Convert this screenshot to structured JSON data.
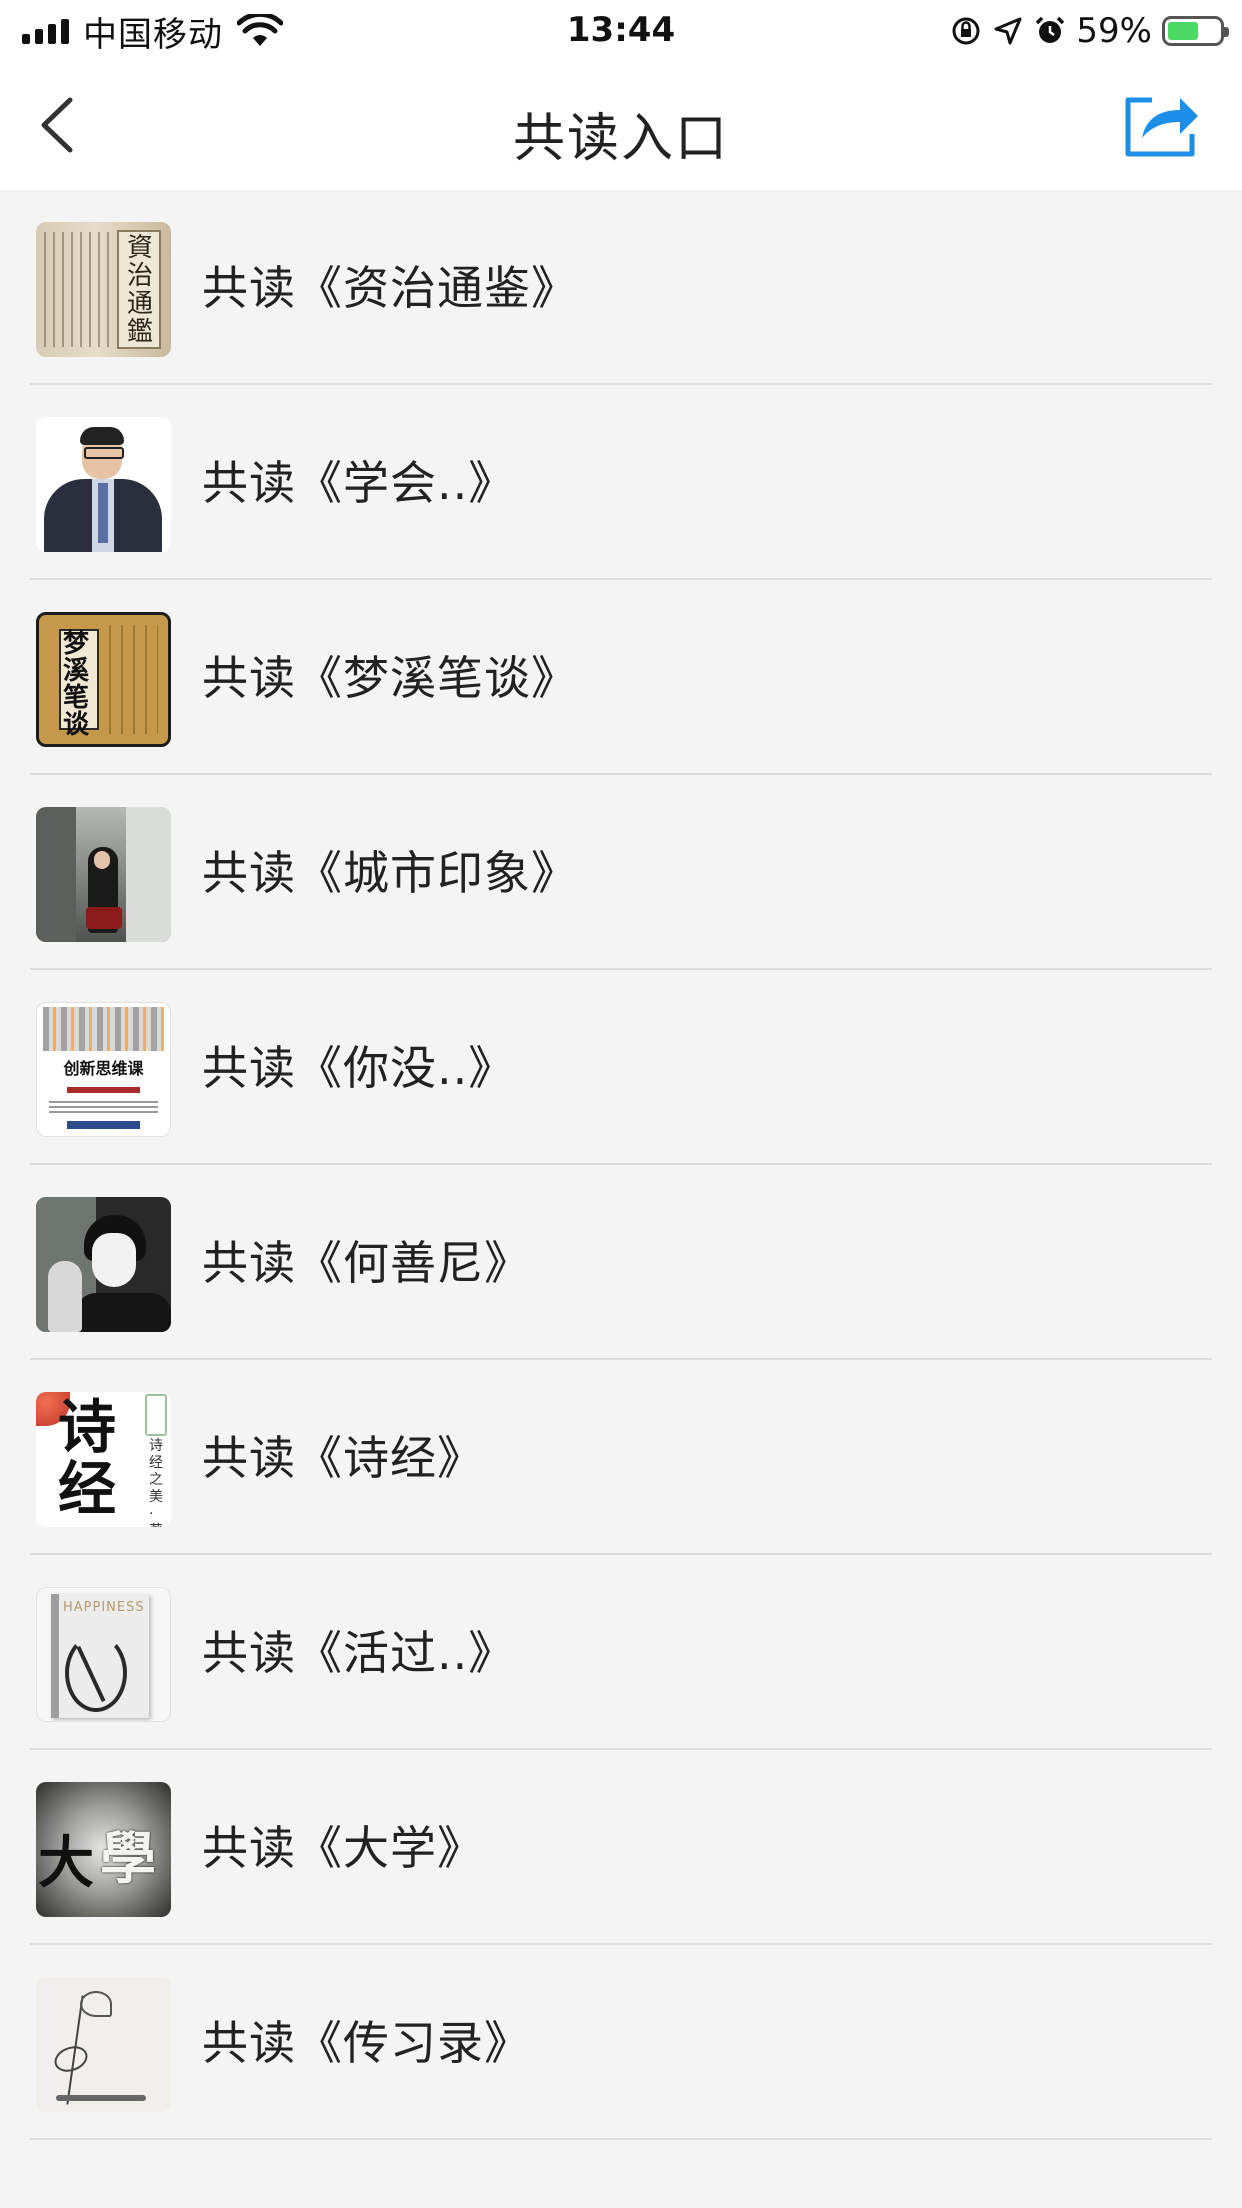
{
  "status_bar": {
    "carrier": "中国移动",
    "time": "13:44",
    "battery_percent": "59%",
    "battery_level": 0.59,
    "battery_color": "#4cd964"
  },
  "nav": {
    "title": "共读入口",
    "back_icon": "chevron-left-icon",
    "share_icon": "share-icon",
    "accent_color": "#1e8fe8"
  },
  "items": [
    {
      "label": "共读《资治通鉴》",
      "cover_text": "資治通鑑"
    },
    {
      "label": "共读《学会..》"
    },
    {
      "label": "共读《梦溪笔谈》",
      "cover_text": "梦溪笔谈"
    },
    {
      "label": "共读《城市印象》"
    },
    {
      "label": "共读《你没..》",
      "cover_text": "创新思维课"
    },
    {
      "label": "共读《何善尼》"
    },
    {
      "label": "共读《诗经》",
      "cover_text": "诗经",
      "cover_subtext": "诗经之美·著"
    },
    {
      "label": "共读《活过..》",
      "cover_text": "HAPPINESS"
    },
    {
      "label": "共读《大学》",
      "cover_text_1": "大",
      "cover_text_2": "學"
    },
    {
      "label": "共读《传习录》"
    }
  ]
}
